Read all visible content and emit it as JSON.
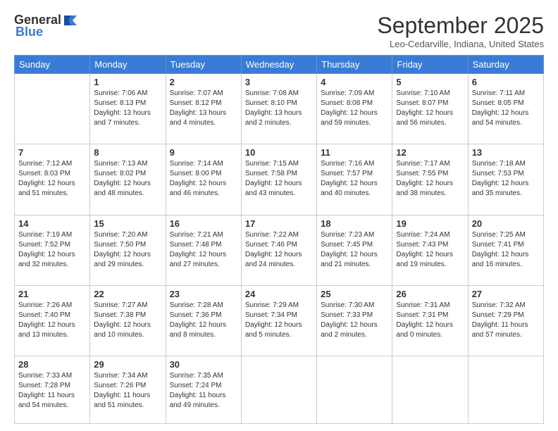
{
  "logo": {
    "general": "General",
    "blue": "Blue"
  },
  "title": "September 2025",
  "location": "Leo-Cedarville, Indiana, United States",
  "days": [
    "Sunday",
    "Monday",
    "Tuesday",
    "Wednesday",
    "Thursday",
    "Friday",
    "Saturday"
  ],
  "weeks": [
    [
      {
        "day": "",
        "info": ""
      },
      {
        "day": "1",
        "info": "Sunrise: 7:06 AM\nSunset: 8:13 PM\nDaylight: 13 hours\nand 7 minutes."
      },
      {
        "day": "2",
        "info": "Sunrise: 7:07 AM\nSunset: 8:12 PM\nDaylight: 13 hours\nand 4 minutes."
      },
      {
        "day": "3",
        "info": "Sunrise: 7:08 AM\nSunset: 8:10 PM\nDaylight: 13 hours\nand 2 minutes."
      },
      {
        "day": "4",
        "info": "Sunrise: 7:09 AM\nSunset: 8:08 PM\nDaylight: 12 hours\nand 59 minutes."
      },
      {
        "day": "5",
        "info": "Sunrise: 7:10 AM\nSunset: 8:07 PM\nDaylight: 12 hours\nand 56 minutes."
      },
      {
        "day": "6",
        "info": "Sunrise: 7:11 AM\nSunset: 8:05 PM\nDaylight: 12 hours\nand 54 minutes."
      }
    ],
    [
      {
        "day": "7",
        "info": "Sunrise: 7:12 AM\nSunset: 8:03 PM\nDaylight: 12 hours\nand 51 minutes."
      },
      {
        "day": "8",
        "info": "Sunrise: 7:13 AM\nSunset: 8:02 PM\nDaylight: 12 hours\nand 48 minutes."
      },
      {
        "day": "9",
        "info": "Sunrise: 7:14 AM\nSunset: 8:00 PM\nDaylight: 12 hours\nand 46 minutes."
      },
      {
        "day": "10",
        "info": "Sunrise: 7:15 AM\nSunset: 7:58 PM\nDaylight: 12 hours\nand 43 minutes."
      },
      {
        "day": "11",
        "info": "Sunrise: 7:16 AM\nSunset: 7:57 PM\nDaylight: 12 hours\nand 40 minutes."
      },
      {
        "day": "12",
        "info": "Sunrise: 7:17 AM\nSunset: 7:55 PM\nDaylight: 12 hours\nand 38 minutes."
      },
      {
        "day": "13",
        "info": "Sunrise: 7:18 AM\nSunset: 7:53 PM\nDaylight: 12 hours\nand 35 minutes."
      }
    ],
    [
      {
        "day": "14",
        "info": "Sunrise: 7:19 AM\nSunset: 7:52 PM\nDaylight: 12 hours\nand 32 minutes."
      },
      {
        "day": "15",
        "info": "Sunrise: 7:20 AM\nSunset: 7:50 PM\nDaylight: 12 hours\nand 29 minutes."
      },
      {
        "day": "16",
        "info": "Sunrise: 7:21 AM\nSunset: 7:48 PM\nDaylight: 12 hours\nand 27 minutes."
      },
      {
        "day": "17",
        "info": "Sunrise: 7:22 AM\nSunset: 7:46 PM\nDaylight: 12 hours\nand 24 minutes."
      },
      {
        "day": "18",
        "info": "Sunrise: 7:23 AM\nSunset: 7:45 PM\nDaylight: 12 hours\nand 21 minutes."
      },
      {
        "day": "19",
        "info": "Sunrise: 7:24 AM\nSunset: 7:43 PM\nDaylight: 12 hours\nand 19 minutes."
      },
      {
        "day": "20",
        "info": "Sunrise: 7:25 AM\nSunset: 7:41 PM\nDaylight: 12 hours\nand 16 minutes."
      }
    ],
    [
      {
        "day": "21",
        "info": "Sunrise: 7:26 AM\nSunset: 7:40 PM\nDaylight: 12 hours\nand 13 minutes."
      },
      {
        "day": "22",
        "info": "Sunrise: 7:27 AM\nSunset: 7:38 PM\nDaylight: 12 hours\nand 10 minutes."
      },
      {
        "day": "23",
        "info": "Sunrise: 7:28 AM\nSunset: 7:36 PM\nDaylight: 12 hours\nand 8 minutes."
      },
      {
        "day": "24",
        "info": "Sunrise: 7:29 AM\nSunset: 7:34 PM\nDaylight: 12 hours\nand 5 minutes."
      },
      {
        "day": "25",
        "info": "Sunrise: 7:30 AM\nSunset: 7:33 PM\nDaylight: 12 hours\nand 2 minutes."
      },
      {
        "day": "26",
        "info": "Sunrise: 7:31 AM\nSunset: 7:31 PM\nDaylight: 12 hours\nand 0 minutes."
      },
      {
        "day": "27",
        "info": "Sunrise: 7:32 AM\nSunset: 7:29 PM\nDaylight: 11 hours\nand 57 minutes."
      }
    ],
    [
      {
        "day": "28",
        "info": "Sunrise: 7:33 AM\nSunset: 7:28 PM\nDaylight: 11 hours\nand 54 minutes."
      },
      {
        "day": "29",
        "info": "Sunrise: 7:34 AM\nSunset: 7:26 PM\nDaylight: 11 hours\nand 51 minutes."
      },
      {
        "day": "30",
        "info": "Sunrise: 7:35 AM\nSunset: 7:24 PM\nDaylight: 11 hours\nand 49 minutes."
      },
      {
        "day": "",
        "info": ""
      },
      {
        "day": "",
        "info": ""
      },
      {
        "day": "",
        "info": ""
      },
      {
        "day": "",
        "info": ""
      }
    ]
  ]
}
